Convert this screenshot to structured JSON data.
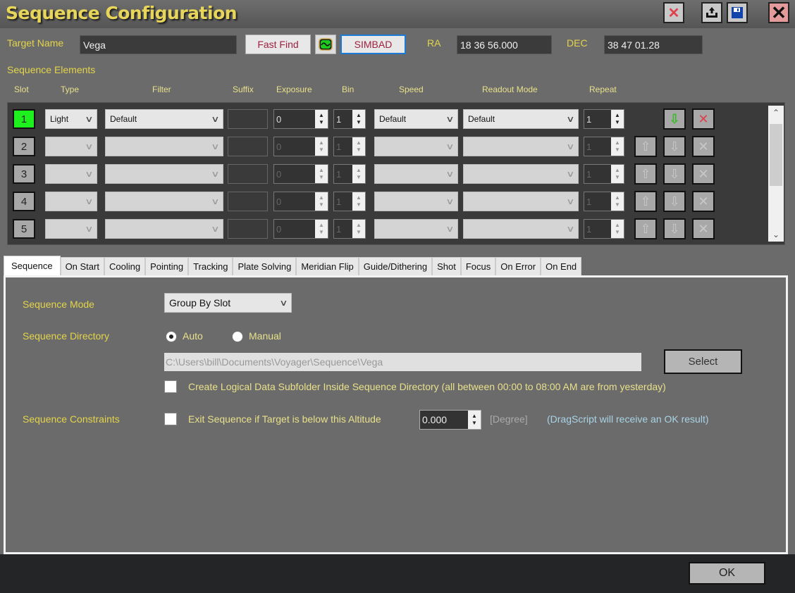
{
  "window": {
    "title": "Sequence Configuration",
    "buttons": [
      "discard",
      "export",
      "save",
      "close"
    ]
  },
  "target": {
    "label": "Target Name",
    "value": "Vega",
    "fast_find_label": "Fast Find",
    "simbad_label": "SIMBAD",
    "ra_label": "RA",
    "ra_value": "18 36 56.000",
    "dec_label": "DEC",
    "dec_value": "38 47 01.28"
  },
  "elements": {
    "title": "Sequence Elements",
    "columns": [
      "Slot",
      "Type",
      "Filter",
      "Suffix",
      "Exposure",
      "Bin",
      "Speed",
      "Readout Mode",
      "Repeat"
    ],
    "rows": [
      {
        "slot": "1",
        "type": "Light",
        "filter": "Default",
        "suffix": "",
        "exposure": "0",
        "bin": "1",
        "speed": "Default",
        "readout": "Default",
        "repeat": "1",
        "enabled": true
      },
      {
        "slot": "2",
        "type": "",
        "filter": "",
        "suffix": "",
        "exposure": "0",
        "bin": "1",
        "speed": "",
        "readout": "",
        "repeat": "1",
        "enabled": false
      },
      {
        "slot": "3",
        "type": "",
        "filter": "",
        "suffix": "",
        "exposure": "0",
        "bin": "1",
        "speed": "",
        "readout": "",
        "repeat": "1",
        "enabled": false
      },
      {
        "slot": "4",
        "type": "",
        "filter": "",
        "suffix": "",
        "exposure": "0",
        "bin": "1",
        "speed": "",
        "readout": "",
        "repeat": "1",
        "enabled": false
      },
      {
        "slot": "5",
        "type": "",
        "filter": "",
        "suffix": "",
        "exposure": "0",
        "bin": "1",
        "speed": "",
        "readout": "",
        "repeat": "1",
        "enabled": false
      }
    ]
  },
  "tabs": [
    {
      "label": "Sequence",
      "active": true
    },
    {
      "label": "On Start"
    },
    {
      "label": "Cooling"
    },
    {
      "label": "Pointing"
    },
    {
      "label": "Tracking"
    },
    {
      "label": "Plate Solving"
    },
    {
      "label": "Meridian Flip"
    },
    {
      "label": "Guide/Dithering"
    },
    {
      "label": "Shot"
    },
    {
      "label": "Focus"
    },
    {
      "label": "On Error"
    },
    {
      "label": "On End"
    }
  ],
  "sequence_tab": {
    "mode_label": "Sequence Mode",
    "mode_value": "Group By Slot",
    "directory_label": "Sequence Directory",
    "radio_auto": "Auto",
    "radio_manual": "Manual",
    "directory_selected": "Auto",
    "directory_path": "C:\\Users\\bill\\Documents\\Voyager\\Sequence\\Vega",
    "select_label": "Select",
    "subfolder_label": "Create Logical Data Subfolder Inside Sequence Directory (all between 00:00 to 08:00 AM are from yesterday)",
    "subfolder_checked": false,
    "constraints_label": "Sequence Constraints",
    "exit_label": "Exit Sequence if Target is below this Altitude",
    "exit_checked": false,
    "altitude_value": "0.000",
    "altitude_unit": "[Degree]",
    "dragscript_note": "(DragScript will receive an OK result)"
  },
  "footer": {
    "ok_label": "OK"
  }
}
